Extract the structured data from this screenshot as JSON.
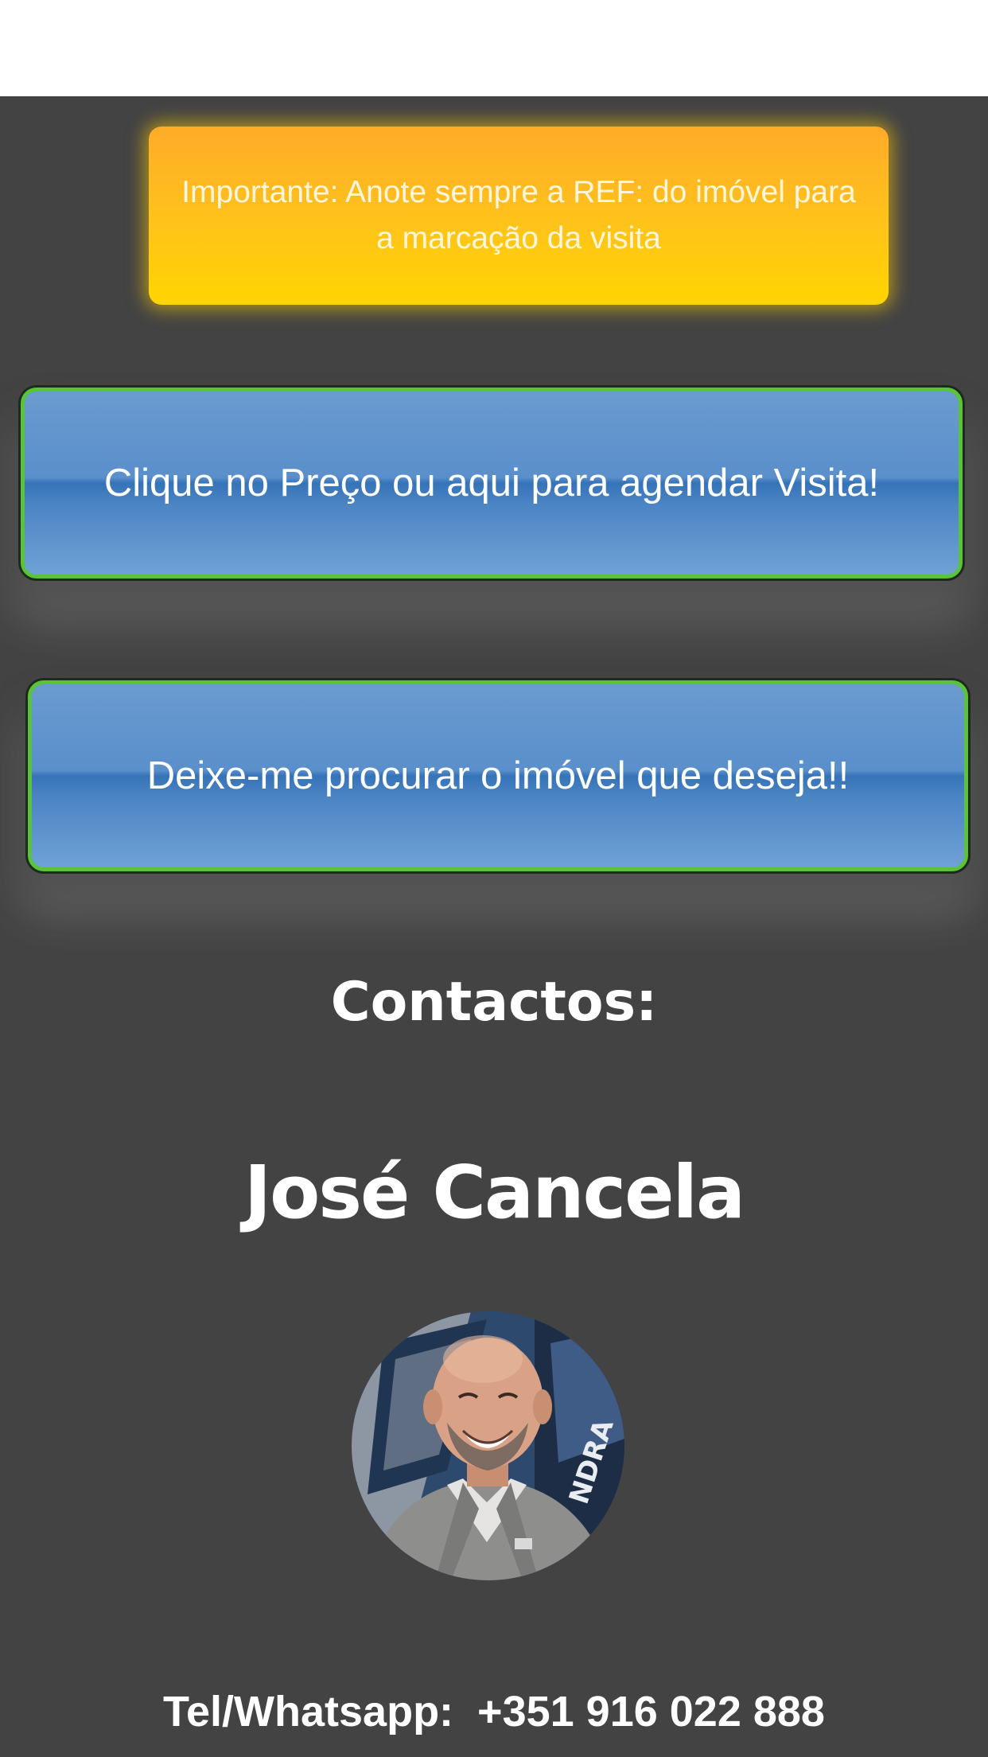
{
  "notice": {
    "text": "Importante: Anote sempre a REF: do imóvel para a marcação da visita"
  },
  "buttons": {
    "schedule_visit": "Clique no Preço ou aqui para agendar Visita!",
    "search_property": "Deixe-me procurar o imóvel que deseja!!"
  },
  "contacts": {
    "heading": "Contactos:",
    "name": "José Cancela",
    "phone_line": "Tel/Whatsapp:  +351 916 022 888"
  },
  "colors": {
    "background": "#434343",
    "notice_top": "#ffab2a",
    "notice_bottom": "#ffd500",
    "button_blue": "#4a86c6",
    "button_border": "#59c43a"
  }
}
